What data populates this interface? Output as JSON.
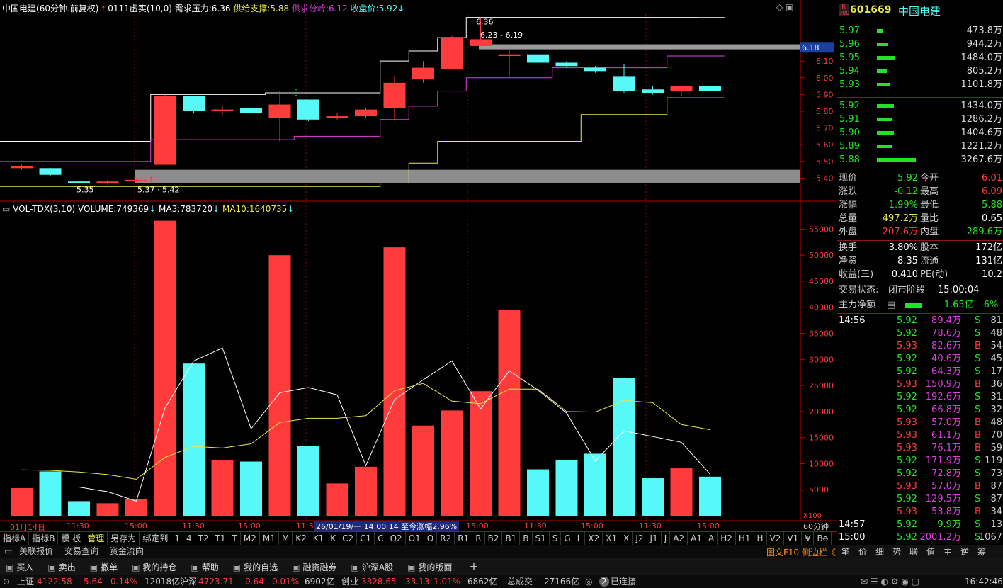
{
  "header": {
    "stock_name": "中国电建",
    "period": "(60分钟.前复权)",
    "code_label": "0111虚实(10,0)",
    "demand_label": "需求压力:",
    "demand_value": "6.36",
    "supply_label": "供给支撑:",
    "supply_value": "5.88",
    "split_label": "供求分岭:",
    "split_value": "6.12",
    "close_label": "收盘价:",
    "close_value": "5.92"
  },
  "price_annotations": {
    "high_marker": "6.36",
    "range_marker": "6.23 - 6.19",
    "low_marker": "5.35",
    "low_marker2": "5.37 · 5.42",
    "current_tag": "6.18"
  },
  "price_axis": [
    "6.10",
    "6.00",
    "5.90",
    "5.80",
    "5.70",
    "5.60",
    "5.50",
    "5.40"
  ],
  "volume_header": {
    "title": "VOL-TDX(3,10)",
    "volume_label": "VOLUME:",
    "volume_value": "749369",
    "ma3_label": "MA3:",
    "ma3_value": "783720",
    "ma10_label": "MA10:",
    "ma10_value": "1640735"
  },
  "volume_axis": [
    "55000",
    "50000",
    "45000",
    "40000",
    "35000",
    "30000",
    "25000",
    "20000",
    "15000",
    "10000",
    "5000"
  ],
  "volume_axis_unit": "X100",
  "time_axis": [
    "01月14日",
    "11:30",
    "15:00",
    "11:30",
    "15:00",
    "11:3",
    "15:00",
    "11:30",
    "15:00",
    "11:30",
    "15:00"
  ],
  "time_tooltip": "26/01/19/一 14:00 14 至今涨幅2.96%",
  "period_label": "60分钟",
  "candles": [
    {
      "o": 5.47,
      "c": 5.46,
      "h": 5.48,
      "l": 5.45,
      "up": true
    },
    {
      "o": 5.46,
      "c": 5.42,
      "h": 5.46,
      "l": 5.41,
      "up": false
    },
    {
      "o": 5.38,
      "c": 5.37,
      "h": 5.4,
      "l": 5.35,
      "up": false
    },
    {
      "o": 5.37,
      "c": 5.38,
      "h": 5.39,
      "l": 5.36,
      "up": true
    },
    {
      "o": 5.38,
      "c": 5.39,
      "h": 5.4,
      "l": 5.37,
      "up": true
    },
    {
      "o": 5.48,
      "c": 5.89,
      "h": 5.9,
      "l": 5.48,
      "up": true
    },
    {
      "o": 5.89,
      "c": 5.8,
      "h": 5.89,
      "l": 5.79,
      "up": false
    },
    {
      "o": 5.8,
      "c": 5.81,
      "h": 5.83,
      "l": 5.78,
      "up": true
    },
    {
      "o": 5.82,
      "c": 5.79,
      "h": 5.83,
      "l": 5.78,
      "up": false
    },
    {
      "o": 5.76,
      "c": 5.84,
      "h": 5.92,
      "l": 5.62,
      "up": true
    },
    {
      "o": 5.87,
      "c": 5.75,
      "h": 5.87,
      "l": 5.74,
      "up": false
    },
    {
      "o": 5.76,
      "c": 5.77,
      "h": 5.79,
      "l": 5.75,
      "up": true
    },
    {
      "o": 5.77,
      "c": 5.81,
      "h": 5.82,
      "l": 5.76,
      "up": true
    },
    {
      "o": 5.82,
      "c": 5.97,
      "h": 6.01,
      "l": 5.75,
      "up": true
    },
    {
      "o": 5.99,
      "c": 6.06,
      "h": 6.1,
      "l": 5.97,
      "up": true
    },
    {
      "o": 6.05,
      "c": 6.24,
      "h": 6.25,
      "l": 6.05,
      "up": true
    },
    {
      "o": 6.19,
      "c": 6.23,
      "h": 6.36,
      "l": 6.19,
      "up": true
    },
    {
      "o": 6.13,
      "c": 6.14,
      "h": 6.18,
      "l": 6.01,
      "up": true
    },
    {
      "o": 6.14,
      "c": 6.09,
      "h": 6.14,
      "l": 6.09,
      "up": false
    },
    {
      "o": 6.09,
      "c": 6.07,
      "h": 6.1,
      "l": 6.06,
      "up": false
    },
    {
      "o": 6.06,
      "c": 6.04,
      "h": 6.07,
      "l": 6.03,
      "up": false
    },
    {
      "o": 6.01,
      "c": 5.92,
      "h": 6.08,
      "l": 5.91,
      "up": false
    },
    {
      "o": 5.93,
      "c": 5.91,
      "h": 5.95,
      "l": 5.9,
      "up": false
    },
    {
      "o": 5.92,
      "c": 5.95,
      "h": 5.95,
      "l": 5.89,
      "up": true
    },
    {
      "o": 5.95,
      "c": 5.92,
      "h": 5.96,
      "l": 5.9,
      "up": false
    }
  ],
  "volumes": [
    5300,
    8500,
    2800,
    2400,
    3200,
    56600,
    29200,
    10600,
    10400,
    50000,
    13400,
    6200,
    9400,
    51500,
    17300,
    20200,
    23900,
    39500,
    8900,
    10700,
    11900,
    26400,
    7200,
    9100,
    7500
  ],
  "ma3": [
    null,
    null,
    5500,
    4600,
    2800,
    20700,
    29700,
    32200,
    16700,
    23600,
    24600,
    23200,
    9600,
    22300,
    26100,
    29700,
    20500,
    27800,
    24100,
    19700,
    10500,
    16300,
    15200,
    14100,
    8000
  ],
  "ma10": [
    8800,
    8700,
    8400,
    7900,
    7000,
    11200,
    13300,
    13000,
    13800,
    17900,
    18700,
    18700,
    19200,
    24000,
    25400,
    22000,
    21500,
    24300,
    24300,
    20000,
    19900,
    22100,
    21700,
    17500,
    16500
  ],
  "upper_line": [
    5.62,
    5.62,
    5.62,
    5.62,
    5.62,
    5.9,
    5.9,
    5.9,
    5.9,
    5.91,
    5.91,
    5.91,
    5.91,
    6.1,
    6.16,
    6.24,
    6.36,
    6.36,
    6.36,
    6.36,
    6.36,
    6.36,
    6.36,
    6.36,
    6.36
  ],
  "mid_line": [
    5.5,
    5.5,
    5.5,
    5.5,
    5.5,
    5.63,
    5.63,
    5.63,
    5.63,
    5.63,
    5.65,
    5.65,
    5.65,
    5.75,
    5.83,
    5.92,
    6.0,
    6.0,
    6.0,
    6.06,
    6.06,
    6.06,
    6.06,
    6.13,
    6.13
  ],
  "lower_line": [
    5.35,
    5.35,
    5.35,
    5.35,
    5.35,
    5.35,
    5.35,
    5.35,
    5.35,
    5.35,
    5.35,
    5.35,
    5.35,
    5.37,
    5.49,
    5.62,
    5.62,
    5.62,
    5.62,
    5.62,
    5.78,
    5.78,
    5.78,
    5.88,
    5.88
  ],
  "tab_strip": [
    "指标A",
    "指标B",
    "模 板",
    "管理",
    "另存为",
    "绑定到",
    "1",
    "4",
    "T2",
    "T1",
    "T",
    "M2",
    "M1",
    "M",
    "K2",
    "K1",
    "K",
    "C2",
    "C1",
    "C",
    "O2",
    "O1",
    "O",
    "R2",
    "R1",
    "R",
    "B2",
    "B1",
    "B",
    "S1",
    "S",
    "G",
    "L",
    "X2",
    "X1",
    "X",
    "J2",
    "J1",
    "J",
    "A2",
    "A1",
    "A",
    "H2",
    "H1",
    "H",
    "V2",
    "V1",
    "V",
    "Bo"
  ],
  "toolbar_items": [
    "关联报价",
    "交易查询",
    "资金流向"
  ],
  "right_panel": {
    "code": "601669",
    "name": "中国电建",
    "badge_top": "R",
    "badge_bottom": "300",
    "asks": [
      {
        "price": "5.97",
        "vol": "473.8万",
        "bar": 8
      },
      {
        "price": "5.96",
        "vol": "944.2万",
        "bar": 16
      },
      {
        "price": "5.95",
        "vol": "1484.0万",
        "bar": 25
      },
      {
        "price": "5.94",
        "vol": "805.2万",
        "bar": 14
      },
      {
        "price": "5.93",
        "vol": "1101.8万",
        "bar": 19
      }
    ],
    "bids": [
      {
        "price": "5.92",
        "vol": "1434.0万",
        "bar": 24
      },
      {
        "price": "5.91",
        "vol": "1286.2万",
        "bar": 22
      },
      {
        "price": "5.90",
        "vol": "1404.6万",
        "bar": 24
      },
      {
        "price": "5.89",
        "vol": "1221.2万",
        "bar": 21
      },
      {
        "price": "5.88",
        "vol": "3267.6万",
        "bar": 55
      }
    ],
    "quote": [
      {
        "l": "现价",
        "v": "5.92",
        "l2": "今开",
        "v2": "6.01"
      },
      {
        "l": "涨跌",
        "v": "-0.12",
        "l2": "最高",
        "v2": "6.09"
      },
      {
        "l": "涨幅",
        "v": "-1.99%",
        "l2": "最低",
        "v2": "5.88"
      },
      {
        "l": "总量",
        "v": "497.2万",
        "l2": "量比",
        "v2": "0.65"
      },
      {
        "l": "外盘",
        "v": "207.6万",
        "l2": "内盘",
        "v2": "289.6万"
      }
    ],
    "quote2": [
      {
        "l": "换手",
        "v": "3.80%",
        "l2": "股本",
        "v2": "172亿"
      },
      {
        "l": "净资",
        "v": "8.35",
        "l2": "流通",
        "v2": "131亿"
      },
      {
        "l": "收益(三)",
        "v": "0.410",
        "l2": "PE(动)",
        "v2": "10.2"
      }
    ],
    "trade_status_label": "交易状态:",
    "trade_status_value": "闭市阶段",
    "trade_time": "15:00:04",
    "net_label": "主力净额",
    "net_value": "-1.65亿",
    "net_pct": "-6%",
    "ticks_time": "14:56",
    "ticks": [
      {
        "p": "5.92",
        "v": "89.4万",
        "s": "S",
        "n": "81"
      },
      {
        "p": "5.92",
        "v": "78.6万",
        "s": "S",
        "n": "48"
      },
      {
        "p": "5.93",
        "v": "82.6万",
        "s": "B",
        "n": "54"
      },
      {
        "p": "5.92",
        "v": "40.6万",
        "s": "S",
        "n": "45"
      },
      {
        "p": "5.92",
        "v": "64.3万",
        "s": "S",
        "n": "17"
      },
      {
        "p": "5.93",
        "v": "150.9万",
        "s": "B",
        "n": "36"
      },
      {
        "p": "5.92",
        "v": "192.6万",
        "s": "S",
        "n": "31"
      },
      {
        "p": "5.92",
        "v": "66.8万",
        "s": "S",
        "n": "32"
      },
      {
        "p": "5.93",
        "v": "57.0万",
        "s": "B",
        "n": "48"
      },
      {
        "p": "5.93",
        "v": "61.1万",
        "s": "B",
        "n": "70"
      },
      {
        "p": "5.93",
        "v": "76.1万",
        "s": "B",
        "n": "59"
      },
      {
        "p": "5.92",
        "v": "171.9万",
        "s": "S",
        "n": "119"
      },
      {
        "p": "5.92",
        "v": "72.8万",
        "s": "S",
        "n": "73"
      },
      {
        "p": "5.93",
        "v": "57.0万",
        "s": "B",
        "n": "87"
      },
      {
        "p": "5.92",
        "v": "129.5万",
        "s": "S",
        "n": "87"
      },
      {
        "p": "5.93",
        "v": "53.8万",
        "s": "B",
        "n": "34"
      }
    ],
    "tick_1457": {
      "t": "14:57",
      "p": "5.92",
      "v": "9.9万",
      "s": "S",
      "n": "13"
    },
    "tick_1500": {
      "t": "15:00",
      "p": "5.92",
      "v": "2001.2万",
      "s": "S",
      "n": "1067"
    },
    "bottom_tabs": [
      "笔",
      "价",
      "细",
      "势",
      "联",
      "值",
      "主",
      "逆",
      "筹"
    ],
    "sidebar_link": "图文F10 侧边栏《"
  },
  "bottom_bar": [
    "买入",
    "卖出",
    "撤单",
    "我的持仓",
    "帮助",
    "我的自选",
    "融资融券",
    "沪深A股",
    "我的版面"
  ],
  "status": {
    "sh_label": "上证",
    "sh_value": "4122.58",
    "sh_chg": "5.64",
    "sh_pct": "0.14%",
    "sh_amt": "12018亿",
    "sz_label": "沪深",
    "sz_value": "4723.71",
    "sz_chg": "0.64",
    "sz_pct": "0.01%",
    "sz_amt": "6902亿",
    "cy_label": "创业",
    "cy_value": "3328.65",
    "cy_chg": "33.13",
    "cy_pct": "1.01%",
    "cy_amt": "6862亿",
    "total_label": "总成交",
    "total_value": "27166亿",
    "conn_count": "2",
    "conn_label": "已连接",
    "clock": "16:42:46"
  },
  "colors": {
    "up": "#ff3b3b",
    "down": "#56f8f8",
    "bg": "#000000",
    "grid": "#8a1a1a"
  }
}
